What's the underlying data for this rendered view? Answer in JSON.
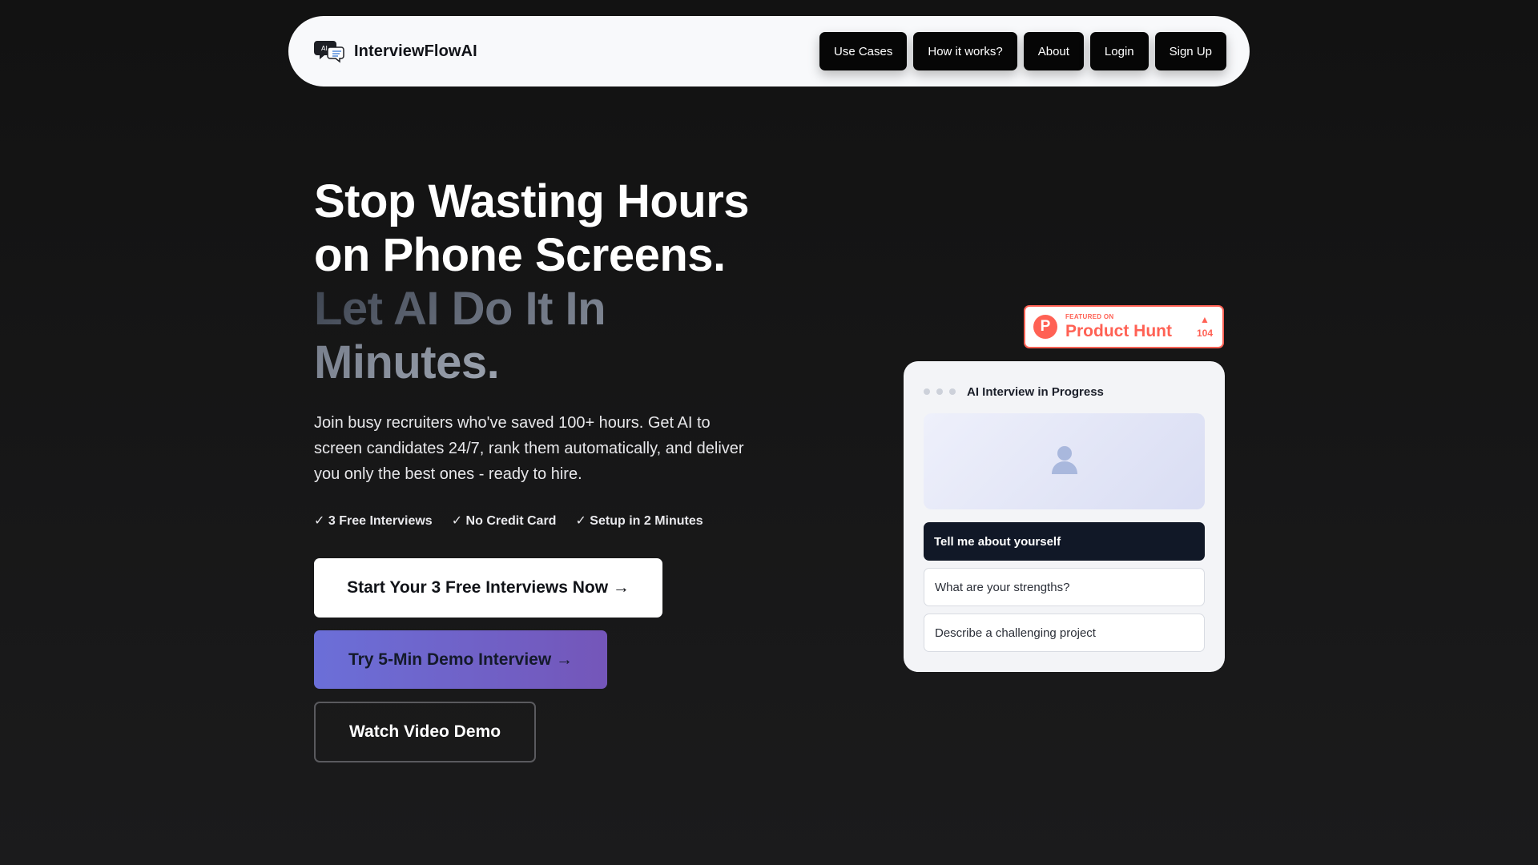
{
  "nav": {
    "brand": "InterviewFlowAI",
    "links": [
      "Use Cases",
      "How it works?",
      "About",
      "Login",
      "Sign Up"
    ]
  },
  "hero": {
    "headline_main": "Stop Wasting Hours on Phone Screens.",
    "headline_accent": "Let AI Do It In Minutes.",
    "subtext": "Join busy recruiters who've saved 100+ hours. Get AI to screen candidates 24/7, rank them automatically, and deliver you only the best ones - ready to hire.",
    "features": [
      "✓ 3 Free Interviews",
      "✓ No Credit Card",
      "✓ Setup in 2 Minutes"
    ],
    "cta_primary": "Start Your 3 Free Interviews Now →",
    "cta_demo": "Try 5-Min Demo Interview →",
    "cta_video": "Watch Video Demo"
  },
  "product_hunt": {
    "featured_on": "FEATURED ON",
    "name": "Product Hunt",
    "logo_letter": "P",
    "arrow": "▲",
    "votes": "104"
  },
  "interview_card": {
    "title": "AI Interview in Progress",
    "questions": [
      "Tell me about yourself",
      "What are your strengths?",
      "Describe a challenging project"
    ],
    "active_question_index": 0
  },
  "colors": {
    "background": "#141414",
    "nav_bg": "#f8f9fb",
    "nav_button": "#060606",
    "product_hunt": "#ff6154",
    "demo_gradient_start": "#6b6fd8",
    "demo_gradient_end": "#7456b9",
    "active_question": "#111827"
  },
  "icons": {
    "brand": "chat-bubbles-icon",
    "avatar": "user-avatar-icon",
    "product_hunt": "product-hunt-logo-icon"
  }
}
